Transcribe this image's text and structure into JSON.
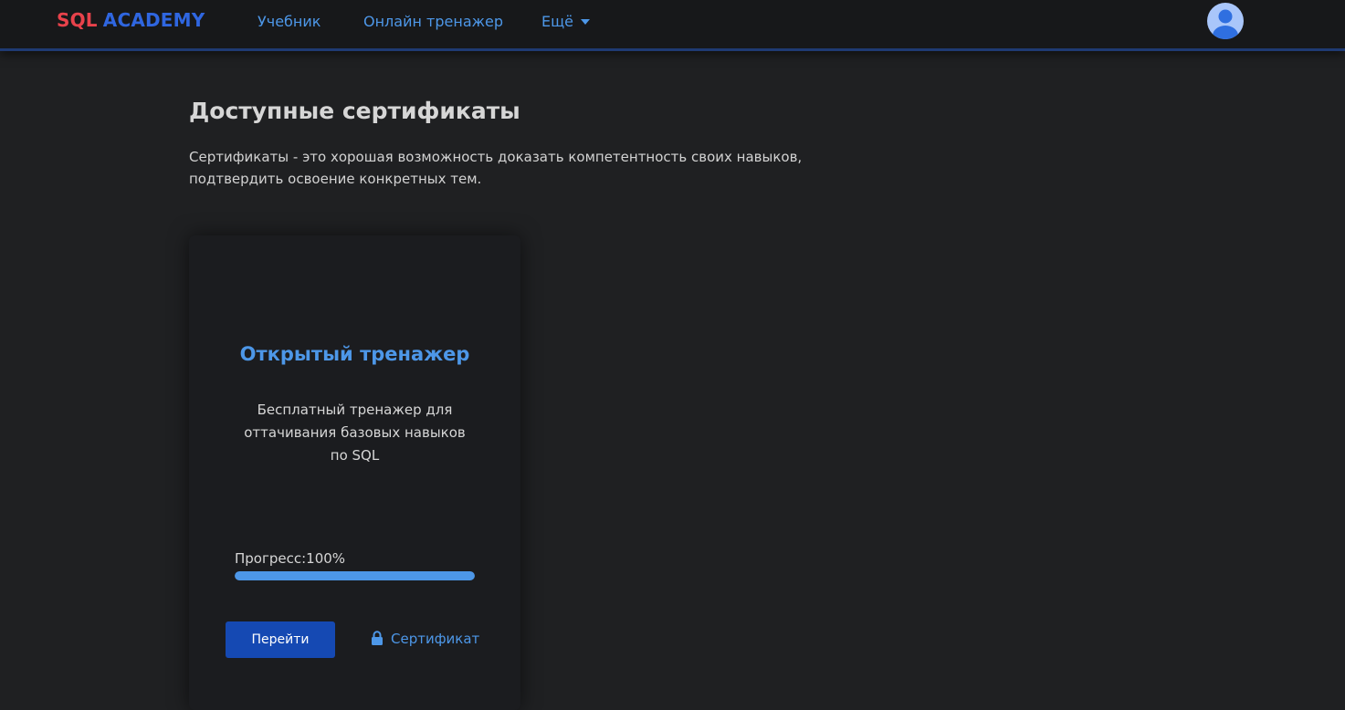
{
  "header": {
    "logo_sql": "SQL",
    "logo_academy": "ACADEMY",
    "nav": {
      "tutorial": "Учебник",
      "trainer": "Онлайн тренажер",
      "more": "Ещё"
    },
    "avatar_icon": "user-avatar-icon"
  },
  "main": {
    "title": "Доступные сертификаты",
    "description": "Сертификаты - это хорошая возможность доказать компетентность своих навыков, подтвердить освоение конкретных тем."
  },
  "card": {
    "title": "Открытый тренажер",
    "description": "Бесплатный тренажер для оттачивания базовых навыков по SQL",
    "progress_label": "Прогресс:100%",
    "progress_value": 1.0,
    "go_button": "Перейти",
    "certificate_link": "Сертификат",
    "certificate_icon": "lock-icon"
  },
  "colors": {
    "background": "#1f2022",
    "topbar": "#17181a",
    "accent": "#4d97e8",
    "button": "#1549b3",
    "logo_sql": "#e8424b",
    "logo_academy": "#2f66e0"
  }
}
